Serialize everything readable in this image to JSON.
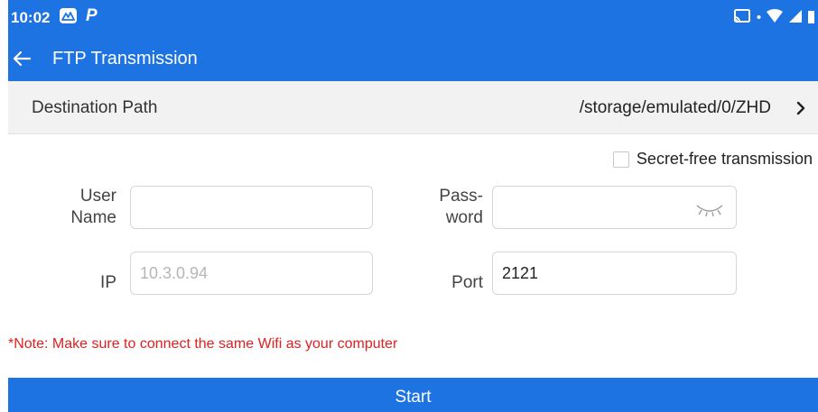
{
  "status_bar": {
    "time": "10:02",
    "p_label": "P"
  },
  "header": {
    "title": "FTP Transmission"
  },
  "destination": {
    "label": "Destination Path",
    "value": "/storage/emulated/0/ZHD"
  },
  "secret_free": {
    "label": "Secret-free transmission",
    "checked": false
  },
  "form": {
    "username_label_line1": "User",
    "username_label_line2": "Name",
    "username_value": "",
    "password_label_line1": "Pass-",
    "password_label_line2": "word",
    "password_value": "",
    "ip_label": "IP",
    "ip_placeholder": "10.3.0.94",
    "port_label": "Port",
    "port_value": "2121"
  },
  "note": "*Note: Make sure to connect the same Wifi as your computer",
  "start_button": "Start",
  "colors": {
    "primary": "#1e73e3",
    "note": "#e02020"
  }
}
